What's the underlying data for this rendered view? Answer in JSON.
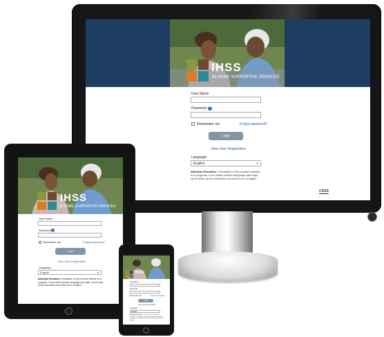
{
  "brand": {
    "logo_text": "IHSS",
    "logo_subtitle": "IN HOME SUPPORTIVE SERVICES",
    "tile_colors": [
      "#8a9a3a",
      "#6b4a2e",
      "#e07a22",
      "#2a8a9a"
    ],
    "band_color": "#1d3d63",
    "accent": "#2a5aa8"
  },
  "login": {
    "username_label": "User Name",
    "password_label": "Password",
    "help_icon": "?",
    "remember_label": "Remember me",
    "forgot_link": "Forgot password?",
    "login_button": "Login",
    "register_link": "New User Registration",
    "language_label": "Language",
    "language_value": "English",
    "notice_title": "Attention Providers:",
    "notice_body": "Translation of the provider website is in progress. If you select another language and login, some fields will be translated and others be in English."
  },
  "footer": {
    "agency_logo": "CDSS"
  },
  "icons": {
    "dropdown": "chevron-down-icon",
    "power": "power-button-icon"
  }
}
